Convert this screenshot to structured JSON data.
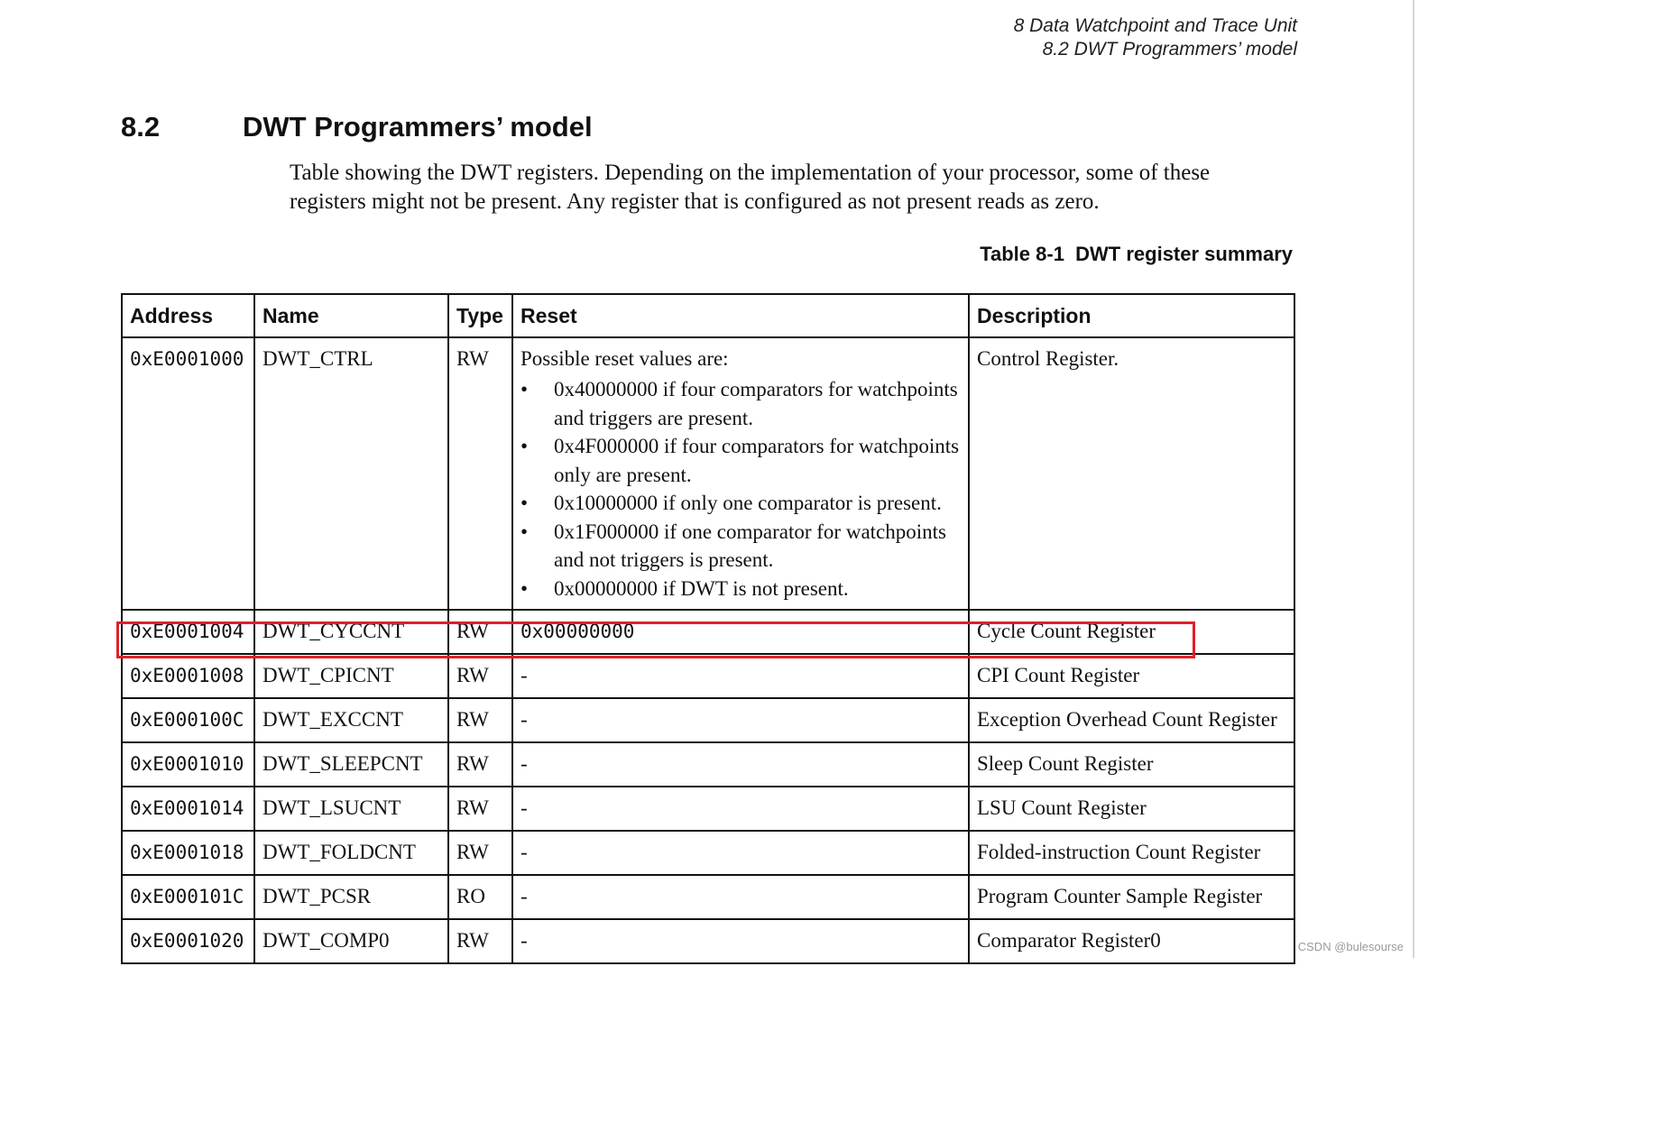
{
  "running_header": {
    "line1": "8 Data Watchpoint and Trace Unit",
    "line2": "8.2 DWT Programmers’ model"
  },
  "section": {
    "number": "8.2",
    "title": "DWT Programmers’ model",
    "intro": "Table showing the DWT registers. Depending on the implementation of your processor, some of these registers might not be present. Any register that is configured as not present reads as zero."
  },
  "table": {
    "caption": "Table 8-1  DWT register summary",
    "headers": {
      "address": "Address",
      "name": "Name",
      "type": "Type",
      "reset": "Reset",
      "description": "Description"
    },
    "ctrl_row": {
      "address": "0xE0001000",
      "name": "DWT_CTRL",
      "type": "RW",
      "reset_intro": "Possible reset values are:",
      "reset_items": [
        "0x40000000 if four comparators for watchpoints and triggers are present.",
        "0x4F000000 if four comparators for watchpoints only are present.",
        "0x10000000 if only one comparator is present.",
        "0x1F000000 if one comparator for watchpoints and not triggers is present.",
        "0x00000000 if DWT is not present."
      ],
      "description": "Control Register."
    },
    "rows": [
      {
        "address": "0xE0001004",
        "name": "DWT_CYCCNT",
        "type": "RW",
        "reset": "0x00000000",
        "description": "Cycle Count Register"
      },
      {
        "address": "0xE0001008",
        "name": "DWT_CPICNT",
        "type": "RW",
        "reset": "-",
        "description": "CPI Count Register"
      },
      {
        "address": "0xE000100C",
        "name": "DWT_EXCCNT",
        "type": "RW",
        "reset": "-",
        "description": "Exception Overhead Count Register"
      },
      {
        "address": "0xE0001010",
        "name": "DWT_SLEEPCNT",
        "type": "RW",
        "reset": "-",
        "description": "Sleep Count Register"
      },
      {
        "address": "0xE0001014",
        "name": "DWT_LSUCNT",
        "type": "RW",
        "reset": "-",
        "description": "LSU Count Register"
      },
      {
        "address": "0xE0001018",
        "name": "DWT_FOLDCNT",
        "type": "RW",
        "reset": "-",
        "description": "Folded-instruction Count Register"
      },
      {
        "address": "0xE000101C",
        "name": "DWT_PCSR",
        "type": "RO",
        "reset": "-",
        "description": "Program Counter Sample Register"
      },
      {
        "address": "0xE0001020",
        "name": "DWT_COMP0",
        "type": "RW",
        "reset": "-",
        "description": "Comparator Register0"
      }
    ]
  },
  "highlight_color": "#e0202a",
  "watermark": "CSDN @bulesourse"
}
